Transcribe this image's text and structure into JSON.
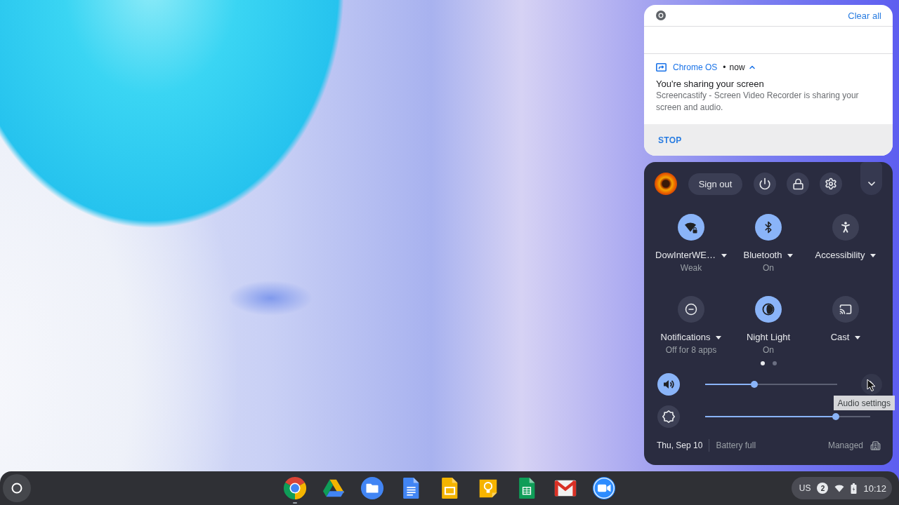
{
  "notification_center": {
    "clear_all": "Clear all",
    "notification": {
      "source": "Chrome OS",
      "separator": "•",
      "time": "now",
      "expanded": true,
      "title": "You're sharing your screen",
      "body": "Screencastify - Screen Video Recorder is sharing your screen and audio.",
      "action": "STOP"
    }
  },
  "quick_settings": {
    "sign_out": "Sign out",
    "expanded": true,
    "pods": [
      {
        "kind": "wifi",
        "label": "DowInterWE…",
        "sublabel": "Weak",
        "on": true,
        "dropdown": true
      },
      {
        "kind": "bluetooth",
        "label": "Bluetooth",
        "sublabel": "On",
        "on": true,
        "dropdown": true
      },
      {
        "kind": "accessibility",
        "label": "Accessibility",
        "on": false,
        "dropdown": true
      },
      {
        "kind": "notifications",
        "label": "Notifications",
        "sublabel": "Off for 8 apps",
        "on": false,
        "dropdown": true
      },
      {
        "kind": "night_light",
        "label": "Night Light",
        "sublabel": "On",
        "on": true,
        "dropdown": false
      },
      {
        "kind": "cast",
        "label": "Cast",
        "on": false,
        "dropdown": true
      }
    ],
    "pages": [
      {
        "selected": true
      },
      {
        "selected": false
      }
    ],
    "sliders": [
      {
        "kind": "volume",
        "level": 0.37,
        "on": true,
        "tooltip": "Audio settings"
      },
      {
        "kind": "brightness",
        "level": 0.79,
        "on": false
      }
    ],
    "date": "Thu, Sep 10",
    "battery": "Battery full",
    "managed": "Managed"
  },
  "shelf": {
    "apps": [
      {
        "kind": "chrome",
        "running": true
      },
      {
        "kind": "drive",
        "running": false
      },
      {
        "kind": "files",
        "running": false
      },
      {
        "kind": "docs",
        "running": false
      },
      {
        "kind": "slides",
        "running": false
      },
      {
        "kind": "keep",
        "running": false
      },
      {
        "kind": "sheets",
        "running": false
      },
      {
        "kind": "gmail",
        "running": false
      },
      {
        "kind": "zoom",
        "running": false
      }
    ],
    "tray": {
      "keyboard_layout": "US",
      "notification_count": "2",
      "time": "10:12"
    }
  }
}
